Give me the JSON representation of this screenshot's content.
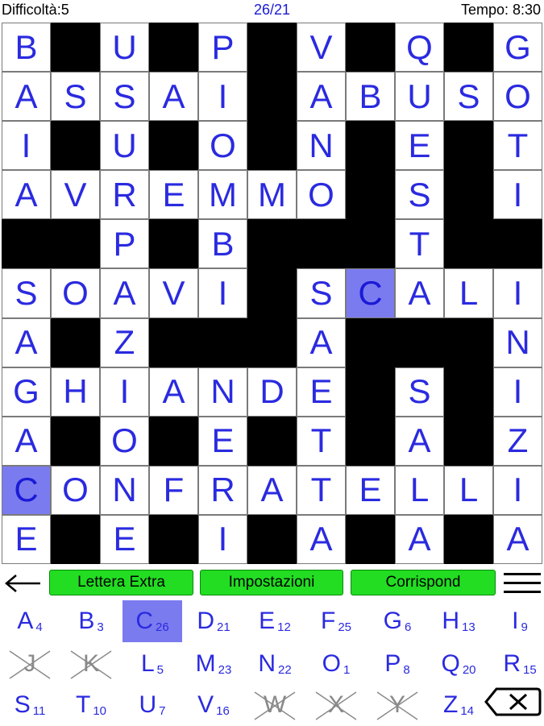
{
  "status": {
    "difficulty": "Difficoltà:5",
    "progress": "26/21",
    "timer": "Tempo: 8:30"
  },
  "grid": {
    "cols": 11,
    "rows": 11,
    "cells": [
      [
        "B",
        "#",
        "U",
        "#",
        "P",
        "#",
        "V",
        "#",
        "Q",
        "#",
        "G"
      ],
      [
        "A",
        "S",
        "S",
        "A",
        "I",
        "#",
        "A",
        "B",
        "U",
        "S",
        "O"
      ],
      [
        "I",
        "#",
        "U",
        "#",
        "O",
        "#",
        "N",
        "#",
        "E",
        "#",
        "T"
      ],
      [
        "A",
        "V",
        "R",
        "E",
        "M",
        "M",
        "O",
        "#",
        "S",
        "#",
        "I"
      ],
      [
        "#",
        "#",
        "P",
        "#",
        "B",
        "#",
        "#",
        "#",
        "T",
        "#",
        "#"
      ],
      [
        "S",
        "O",
        "A",
        "V",
        "I",
        "#",
        "S",
        "C",
        "A",
        "L",
        "I"
      ],
      [
        "A",
        "#",
        "Z",
        "#",
        "#",
        "#",
        "A",
        "#",
        "#",
        "#",
        "N"
      ],
      [
        "G",
        "H",
        "I",
        "A",
        "N",
        "D",
        "E",
        "#",
        "S",
        "#",
        "I"
      ],
      [
        "A",
        "#",
        "O",
        "#",
        "E",
        "#",
        "T",
        "#",
        "A",
        "#",
        "Z"
      ],
      [
        "C",
        "O",
        "N",
        "F",
        "R",
        "A",
        "T",
        "E",
        "L",
        "L",
        "I"
      ],
      [
        "E",
        "#",
        "E",
        "#",
        "I",
        "#",
        "A",
        "#",
        "A",
        "#",
        "A"
      ]
    ],
    "selected": [
      [
        5,
        7
      ],
      [
        9,
        0
      ]
    ]
  },
  "toolbar": {
    "back_icon": "arrow-left-icon",
    "extra_label": "Lettera Extra",
    "settings_label": "Impostazioni",
    "match_label": "Corrispond",
    "menu_icon": "hamburger-menu-icon",
    "button_color": "#22dd22"
  },
  "keyboard": {
    "rows": [
      [
        {
          "l": "A",
          "n": "4"
        },
        {
          "l": "B",
          "n": "3"
        },
        {
          "l": "C",
          "n": "26",
          "sel": true
        },
        {
          "l": "D",
          "n": "21"
        },
        {
          "l": "E",
          "n": "12"
        },
        {
          "l": "F",
          "n": "25"
        },
        {
          "l": "G",
          "n": "6"
        },
        {
          "l": "H",
          "n": "13"
        },
        {
          "l": "I",
          "n": "9"
        }
      ],
      [
        {
          "l": "J",
          "n": "",
          "used": true
        },
        {
          "l": "K",
          "n": "",
          "used": true
        },
        {
          "l": "L",
          "n": "5"
        },
        {
          "l": "M",
          "n": "23"
        },
        {
          "l": "N",
          "n": "22"
        },
        {
          "l": "O",
          "n": "1"
        },
        {
          "l": "P",
          "n": "8"
        },
        {
          "l": "Q",
          "n": "20"
        },
        {
          "l": "R",
          "n": "15"
        }
      ],
      [
        {
          "l": "S",
          "n": "11"
        },
        {
          "l": "T",
          "n": "10"
        },
        {
          "l": "U",
          "n": "7"
        },
        {
          "l": "V",
          "n": "16"
        },
        {
          "l": "W",
          "n": "",
          "used": true
        },
        {
          "l": "X",
          "n": "",
          "used": true
        },
        {
          "l": "Y",
          "n": "",
          "used": true
        },
        {
          "l": "Z",
          "n": "14"
        }
      ]
    ],
    "delete_icon": "backspace-icon"
  },
  "colors": {
    "accent": "#7b7bf0",
    "letter": "#2a2ae0",
    "progress": "#1a1ad6"
  }
}
